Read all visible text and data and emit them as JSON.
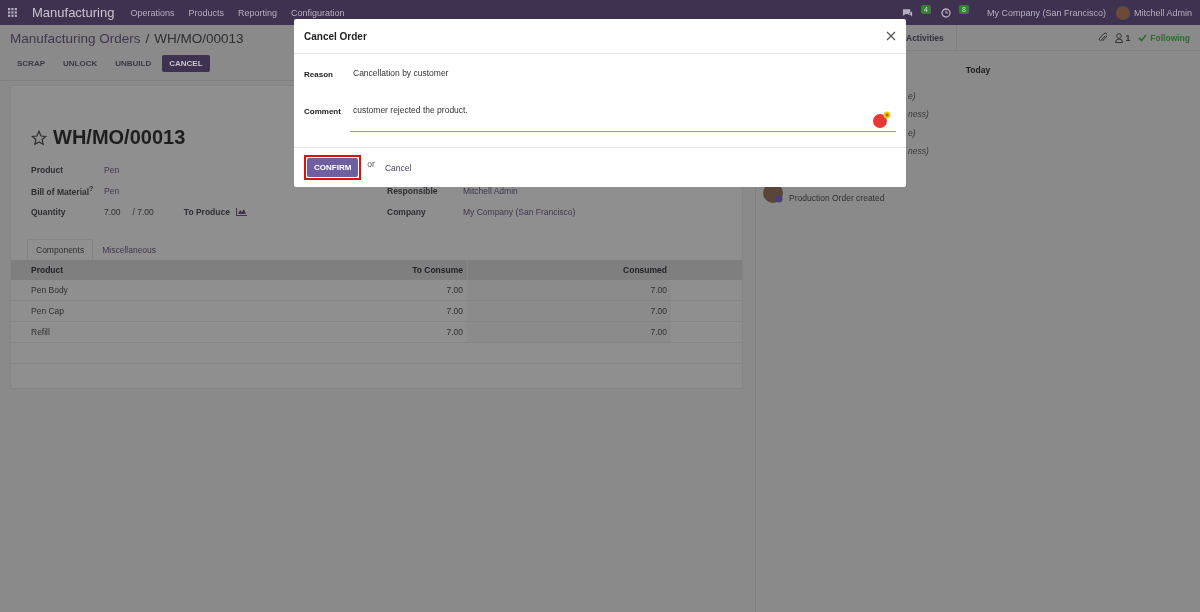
{
  "navbar": {
    "app": "Manufacturing",
    "menus": [
      "Operations",
      "Products",
      "Reporting",
      "Configuration"
    ],
    "messages_count": "4",
    "activities_count": "8",
    "company": "My Company (San Francisco)",
    "user": "Mitchell Admin"
  },
  "breadcrumb": {
    "parent": "Manufacturing Orders",
    "separator": "/",
    "current": "WH/MO/00013"
  },
  "actions": [
    {
      "label": "SCRAP",
      "primary": false
    },
    {
      "label": "UNLOCK",
      "primary": false
    },
    {
      "label": "UNBUILD",
      "primary": false
    },
    {
      "label": "CANCEL",
      "primary": true
    }
  ],
  "form": {
    "title": "WH/MO/00013",
    "starred": false,
    "left_fields": [
      {
        "label": "Product",
        "value": "Pen"
      },
      {
        "label": "Bill of Material$^{?}$",
        "value": "Pen"
      }
    ],
    "quantity": {
      "label": "Quantity",
      "value": "7.00",
      "total": "/ 7.00",
      "state_label": "To Produce"
    },
    "right_fields": [
      {
        "label": "Responsible",
        "value": "Mitchell Admin"
      },
      {
        "label": "Company",
        "value": "My Company (San Francisco)"
      }
    ],
    "tabs": [
      {
        "label": "Components",
        "selected": true
      },
      {
        "label": "Miscellaneous",
        "selected": false
      }
    ],
    "table": {
      "columns": [
        "Product",
        "To Consume",
        "Consumed"
      ],
      "rows": [
        [
          "Pen Body",
          "7.00",
          "7.00"
        ],
        [
          "Pen Cap",
          "7.00",
          "7.00"
        ],
        [
          "Refill",
          "7.00",
          "7.00"
        ]
      ]
    }
  },
  "chatter": {
    "activities_button": "Activities",
    "followers_count": "1",
    "following": "Following",
    "date_separator": "Today",
    "message_fragments": [
      [
        "e)",
        "ness)"
      ],
      [
        "e)",
        "ness)"
      ]
    ],
    "last_message": "Production Order created"
  },
  "dialog": {
    "title": "Cancel Order",
    "reason_label": "Reason",
    "reason": "Cancellation by customer",
    "comment_label": "Comment",
    "comment": "customer rejected the product.",
    "confirm": "CONFIRM",
    "confirm_highlighted": true,
    "or": "or",
    "cancel": "Cancel"
  }
}
